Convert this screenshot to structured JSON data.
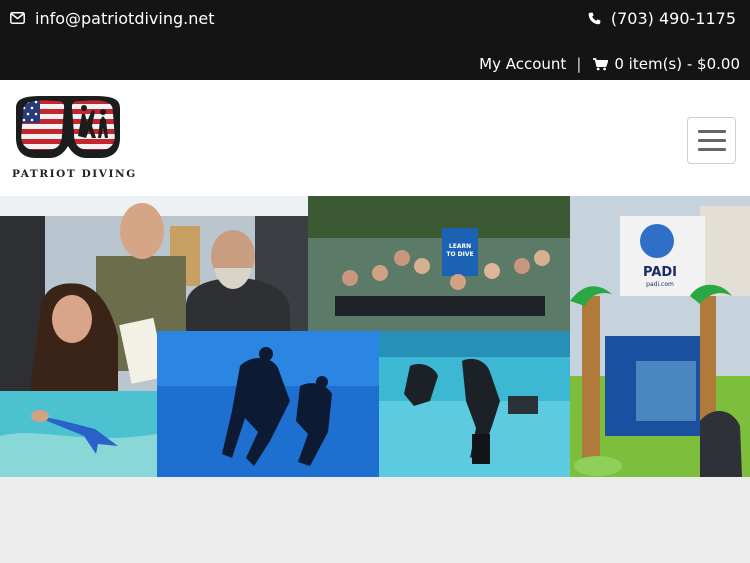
{
  "topbar": {
    "email": "info@patriotdiving.net",
    "phone": "(703) 490-1175",
    "account_label": "My Account",
    "separator": "|",
    "cart_label": "0 item(s) - $0.00",
    "icons": {
      "email": "envelope-icon",
      "phone": "phone-icon",
      "cart": "shopping-cart-icon"
    },
    "background": "#141414"
  },
  "header": {
    "logo_text": "PATRIOT DIVING",
    "menu_icon": "hamburger-menu-icon"
  },
  "banner": {
    "photos": [
      "shop-staff-photo",
      "pool-group-photo",
      "padi-booth-photo",
      "mermaid-pool-photo",
      "scuba-divers-photo",
      "pool-training-photo"
    ],
    "sign_line1": "LEARN",
    "sign_line2": "TO DIVE",
    "padi_label": "PADI",
    "padi_url": "padi.com",
    "colors": {
      "water": "#1d6fd0",
      "pool": "#3cb8d2",
      "booth": "#d8d8d8"
    }
  }
}
